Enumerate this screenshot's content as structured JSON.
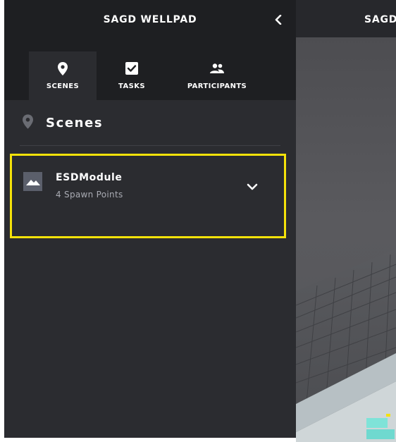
{
  "sidebar": {
    "title": "SAGD WELLPAD",
    "collapse_icon": "chevron-left-icon",
    "tabs": [
      {
        "label": "SCENES",
        "icon": "map-pin-icon",
        "active": true
      },
      {
        "label": "TASKS",
        "icon": "checkbox-icon",
        "active": false
      },
      {
        "label": "PARTICIPANTS",
        "icon": "people-icon",
        "active": false
      }
    ],
    "section": {
      "title": "Scenes",
      "icon": "map-pin-icon"
    },
    "scenes": [
      {
        "name": "ESDModule",
        "subtitle": "4 Spawn Points",
        "thumbnail_icon": "mountain-image-icon",
        "expand_icon": "chevron-down-icon",
        "highlighted": true
      }
    ]
  },
  "viewport": {
    "title": "SAGD WELLPAD"
  },
  "colors": {
    "sidebar_bg": "#2b2c30",
    "header_bg": "#1e1f22",
    "highlight": "#f5e20a",
    "viewport_bg": "#515155"
  }
}
